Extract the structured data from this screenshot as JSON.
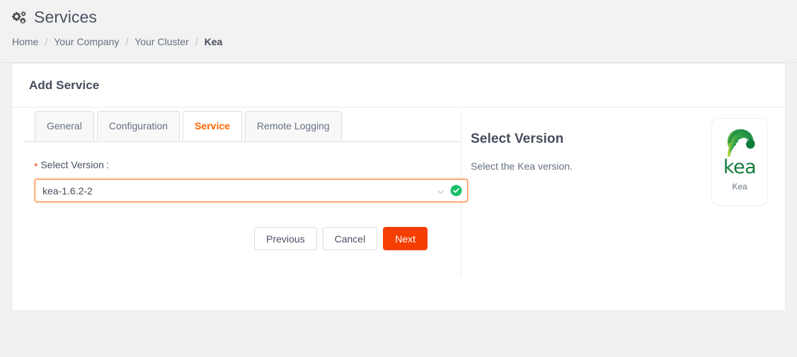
{
  "header": {
    "icon": "cogs-icon",
    "title": "Services",
    "breadcrumb": [
      {
        "label": "Home",
        "current": false
      },
      {
        "label": "Your Company",
        "current": false
      },
      {
        "label": "Your Cluster",
        "current": false
      },
      {
        "label": "Kea",
        "current": true
      }
    ],
    "separator": "/"
  },
  "card": {
    "title": "Add Service",
    "tabs": [
      {
        "label": "General",
        "active": false
      },
      {
        "label": "Configuration",
        "active": false
      },
      {
        "label": "Service",
        "active": true
      },
      {
        "label": "Remote Logging",
        "active": false
      }
    ],
    "form": {
      "required_marker": "*",
      "label": "Select Version",
      "colon": ":",
      "select": {
        "value": "kea-1.6.2-2",
        "placeholder": "Select Version",
        "chevron_icon": "chevron-down-icon",
        "valid_icon": "check-circle-icon",
        "options": [
          "kea-1.6.2-2"
        ]
      }
    },
    "buttons": {
      "previous": "Previous",
      "cancel": "Cancel",
      "next": "Next"
    },
    "info": {
      "title": "Select Version",
      "description": "Select the Kea version.",
      "logo": {
        "icon": "kea-parrot-logo-icon",
        "wordmark": "kea",
        "caption": "Kea"
      }
    }
  },
  "colors": {
    "accent_orange": "#ff6600",
    "primary_button": "#f63e02",
    "focus_border": "#ff7b28",
    "required_star": "#ed3f14",
    "valid_green": "#19be6b",
    "logo_green": "#157a3c",
    "page_background": "#f1f1f1",
    "text_primary": "#464c5b",
    "text_secondary": "#657180"
  }
}
